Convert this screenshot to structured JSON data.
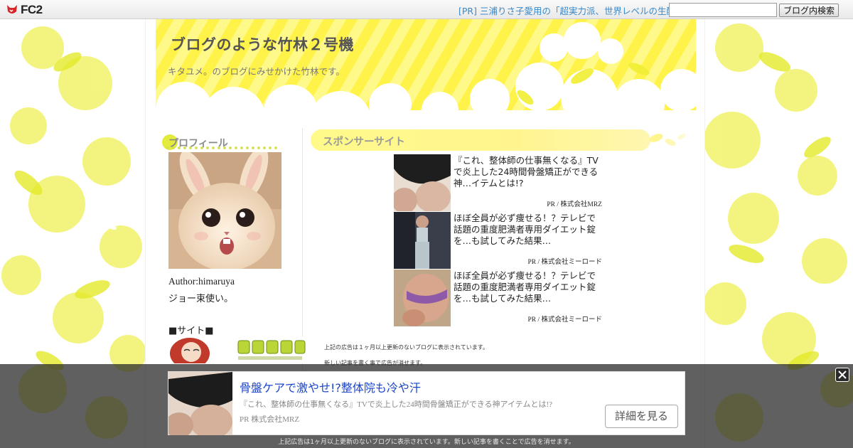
{
  "fc2bar": {
    "logo_text": "FC2",
    "pr_link": "[PR] 三浦りさ子愛用の「超実力派、世界レベルの生酵",
    "search_placeholder": "",
    "search_button": "ブログ内検索"
  },
  "header": {
    "title": "ブログのような竹林２号機",
    "description": "キタユメ。のブログにみせかけた竹林です。"
  },
  "sidebar": {
    "profile_heading": "プロフィール",
    "author": "Author:himaruya",
    "author_desc": "ジョー束使い。",
    "site_heading": "■サイト■"
  },
  "sponsor": {
    "heading": "スポンサーサイト",
    "ads": [
      {
        "title": "『これ、整体師の仕事無くなる』TVで炎上した24時間骨盤矯正ができる神…イテムとは!?",
        "source": "PR / 株式会社MRZ"
      },
      {
        "title": "ほぼ全員が必ず痩せる！？テレビで話題の重度肥満者専用ダイエット錠を…も試してみた結果…",
        "source": "PR / 株式会社ミーロード"
      },
      {
        "title": "ほぼ全員が必ず痩せる！？テレビで話題の重度肥満者専用ダイエット錠を…も試してみた結果…",
        "source": "PR / 株式会社ミーロード"
      }
    ],
    "notice_1": "上記の広告は１ヶ月以上更新のないブログに表示されています。",
    "notice_2": "新しい記事を書く事で広告が消せます。"
  },
  "overlay_ad": {
    "title": "骨盤ケアで激やせ!?整体院も冷や汗",
    "text": "『これ、整体師の仕事無くなる』TVで炎上した24時間骨盤矯正ができる神アイテムとは!?",
    "source": "PR 株式会社MRZ",
    "button": "詳細を見る",
    "notice": "上記広告は1ヶ月以上更新のないブログに表示されています。新しい記事を書くことで広告を消せます。"
  },
  "colors": {
    "accent_yellow": "#fff34a",
    "link_blue": "#3a88c8",
    "overlay_title_blue": "#1a45c8"
  }
}
